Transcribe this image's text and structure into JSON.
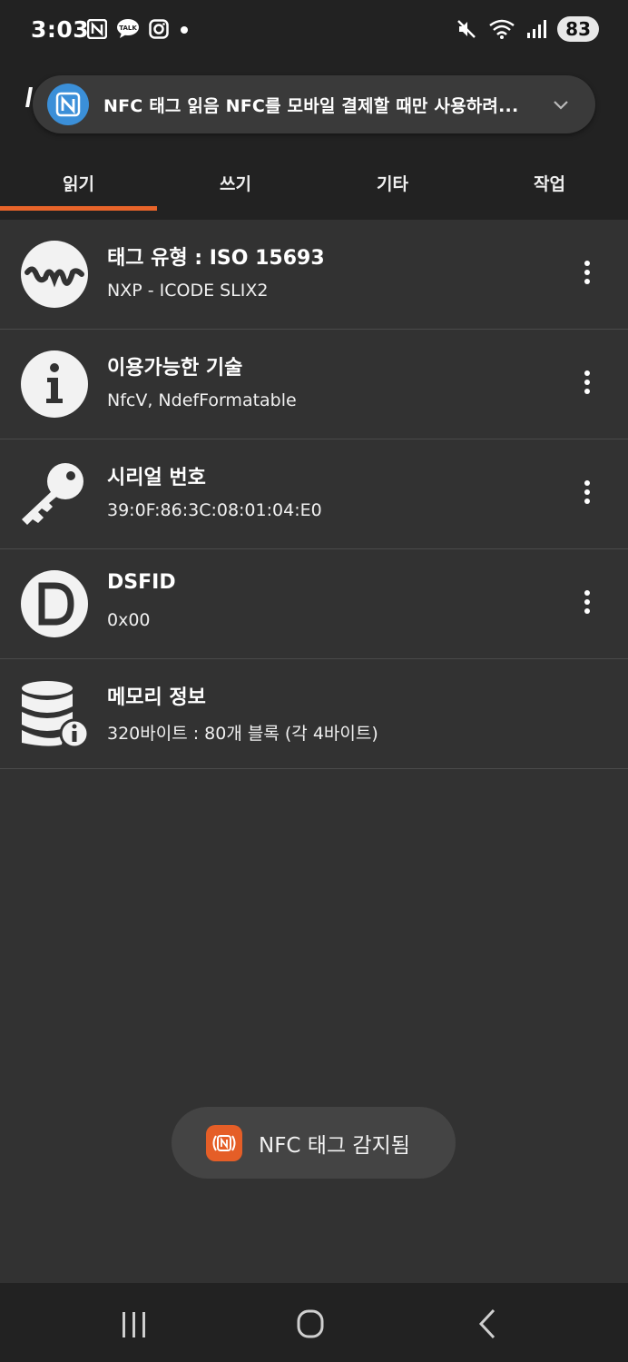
{
  "status": {
    "time": "3:03",
    "battery": "83",
    "left_icons": [
      "nfc-icon",
      "kakaotalk-icon",
      "instagram-icon",
      "dot-icon"
    ],
    "right_icons": [
      "mute-icon",
      "wifi-icon",
      "signal-icon"
    ]
  },
  "notification": {
    "text": "NFC 태그 읽음  NFC를 모바일 결제할 때만 사용하려...",
    "icon": "nfc-n-icon"
  },
  "tabs": [
    {
      "label": "읽기",
      "active": true
    },
    {
      "label": "쓰기",
      "active": false
    },
    {
      "label": "기타",
      "active": false
    },
    {
      "label": "작업",
      "active": false
    }
  ],
  "rows": [
    {
      "icon": "waveform-icon",
      "title": "태그 유형 : ISO 15693",
      "subtitle": "NXP - ICODE SLIX2",
      "has_menu": true
    },
    {
      "icon": "info-icon",
      "title": "이용가능한 기술",
      "subtitle": "NfcV, NdefFormatable",
      "has_menu": true
    },
    {
      "icon": "key-icon",
      "title": "시리얼 번호",
      "subtitle": "39:0F:86:3C:08:01:04:E0",
      "has_menu": true
    },
    {
      "icon": "d-letter-icon",
      "title": "DSFID",
      "subtitle": "0x00",
      "has_menu": true
    },
    {
      "icon": "database-info-icon",
      "title": "메모리 정보",
      "subtitle": "320바이트 : 80개 블록 (각 4바이트)",
      "has_menu": false
    }
  ],
  "toast": {
    "text": "NFC 태그 감지됨",
    "icon": "nfc-toast-icon"
  },
  "colors": {
    "accent": "#e8642a",
    "nfc_blue": "#3b8fd8",
    "background": "#323232",
    "bar": "#222222"
  }
}
